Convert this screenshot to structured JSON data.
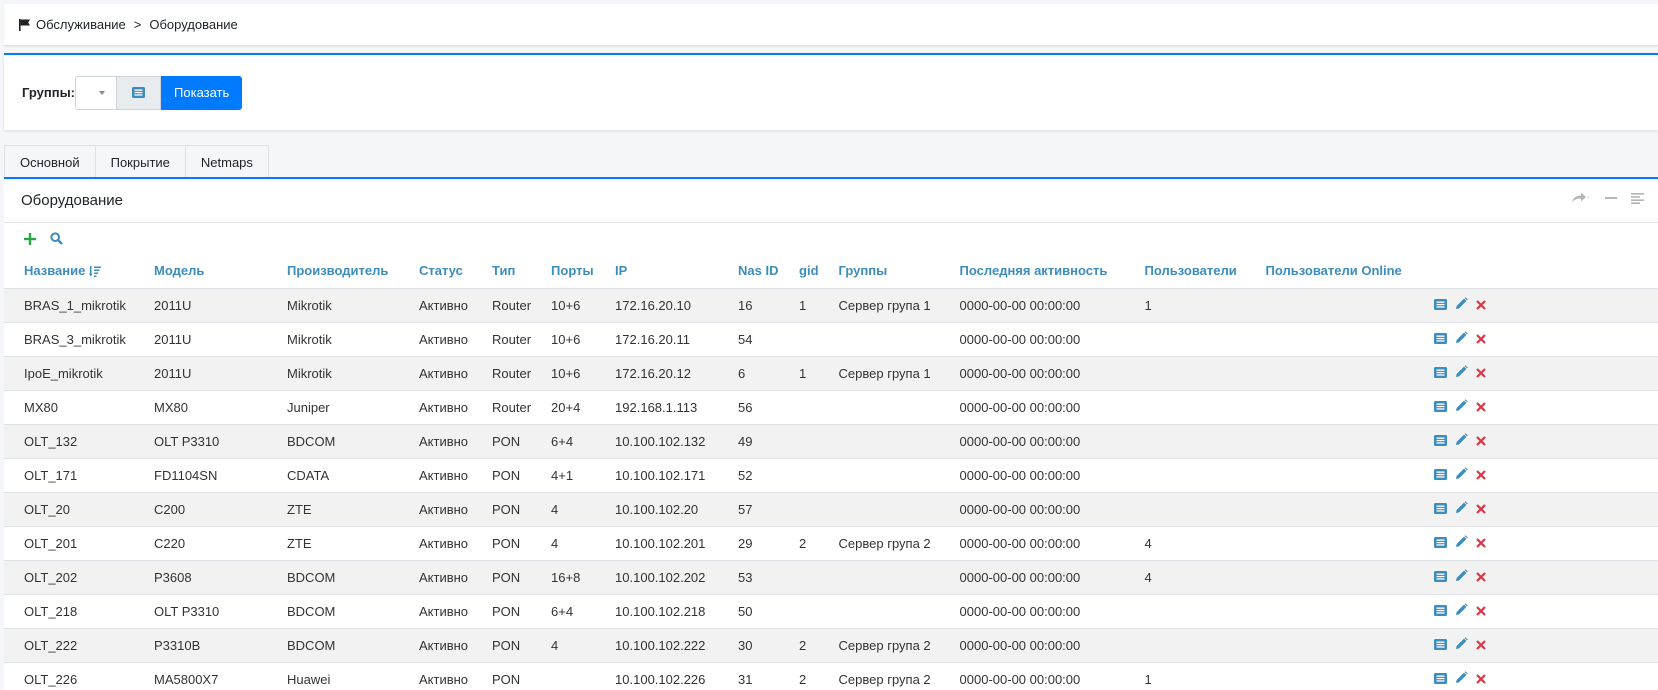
{
  "breadcrumb": {
    "items": [
      "Обслуживание",
      "Оборудование"
    ],
    "separator": ">"
  },
  "filter": {
    "label": "Группы:",
    "show_label": "Показать"
  },
  "tabs": [
    "Основной",
    "Покрытие",
    "Netmaps"
  ],
  "card": {
    "title": "Оборудование"
  },
  "columns": [
    "Название",
    "Модель",
    "Производитель",
    "Статус",
    "Тип",
    "Порты",
    "IP",
    "Nas ID",
    "gid",
    "Группы",
    "Последняя активность",
    "Пользователи",
    "Пользователи Online"
  ],
  "rows": [
    [
      "BRAS_1_mikrotik",
      "2011U",
      "Mikrotik",
      "Активно",
      "Router",
      "10+6",
      "172.16.20.10",
      "16",
      "1",
      "Сервер група 1",
      "0000-00-00 00:00:00",
      "1",
      ""
    ],
    [
      "BRAS_3_mikrotik",
      "2011U",
      "Mikrotik",
      "Активно",
      "Router",
      "10+6",
      "172.16.20.11",
      "54",
      "",
      "",
      "0000-00-00 00:00:00",
      "",
      ""
    ],
    [
      "IpoE_mikrotik",
      "2011U",
      "Mikrotik",
      "Активно",
      "Router",
      "10+6",
      "172.16.20.12",
      "6",
      "1",
      "Сервер група 1",
      "0000-00-00 00:00:00",
      "",
      ""
    ],
    [
      "MX80",
      "MX80",
      "Juniper",
      "Активно",
      "Router",
      "20+4",
      "192.168.1.113",
      "56",
      "",
      "",
      "0000-00-00 00:00:00",
      "",
      ""
    ],
    [
      "OLT_132",
      "OLT P3310",
      "BDCOM",
      "Активно",
      "PON",
      "6+4",
      "10.100.102.132",
      "49",
      "",
      "",
      "0000-00-00 00:00:00",
      "",
      ""
    ],
    [
      "OLT_171",
      "FD1104SN",
      "CDATA",
      "Активно",
      "PON",
      "4+1",
      "10.100.102.171",
      "52",
      "",
      "",
      "0000-00-00 00:00:00",
      "",
      ""
    ],
    [
      "OLT_20",
      "C200",
      "ZTE",
      "Активно",
      "PON",
      "4",
      "10.100.102.20",
      "57",
      "",
      "",
      "0000-00-00 00:00:00",
      "",
      ""
    ],
    [
      "OLT_201",
      "C220",
      "ZTE",
      "Активно",
      "PON",
      "4",
      "10.100.102.201",
      "29",
      "2",
      "Сервер група 2",
      "0000-00-00 00:00:00",
      "4",
      ""
    ],
    [
      "OLT_202",
      "P3608",
      "BDCOM",
      "Активно",
      "PON",
      "16+8",
      "10.100.102.202",
      "53",
      "",
      "",
      "0000-00-00 00:00:00",
      "4",
      ""
    ],
    [
      "OLT_218",
      "OLT P3310",
      "BDCOM",
      "Активно",
      "PON",
      "6+4",
      "10.100.102.218",
      "50",
      "",
      "",
      "0000-00-00 00:00:00",
      "",
      ""
    ],
    [
      "OLT_222",
      "P3310B",
      "BDCOM",
      "Активно",
      "PON",
      "4",
      "10.100.102.222",
      "30",
      "2",
      "Сервер група 2",
      "0000-00-00 00:00:00",
      "",
      ""
    ],
    [
      "OLT_226",
      "MA5800X7",
      "Huawei",
      "Активно",
      "PON",
      "",
      "10.100.102.226",
      "31",
      "2",
      "Сервер група 2",
      "0000-00-00 00:00:00",
      "1",
      ""
    ]
  ],
  "colors": {
    "accent": "#007bff",
    "header_text": "#3c8dbc",
    "delete": "#dc3545",
    "add": "#28a745"
  },
  "icons": {
    "breadcrumb": "flag-icon",
    "list": "list-icon",
    "add": "plus-icon",
    "search": "search-icon",
    "share": "share-icon",
    "minimize": "minus-icon",
    "menu": "menu-icon",
    "sort": "sort-desc-icon",
    "row_view": "list-icon",
    "row_edit": "pencil-icon",
    "row_delete": "close-icon"
  }
}
